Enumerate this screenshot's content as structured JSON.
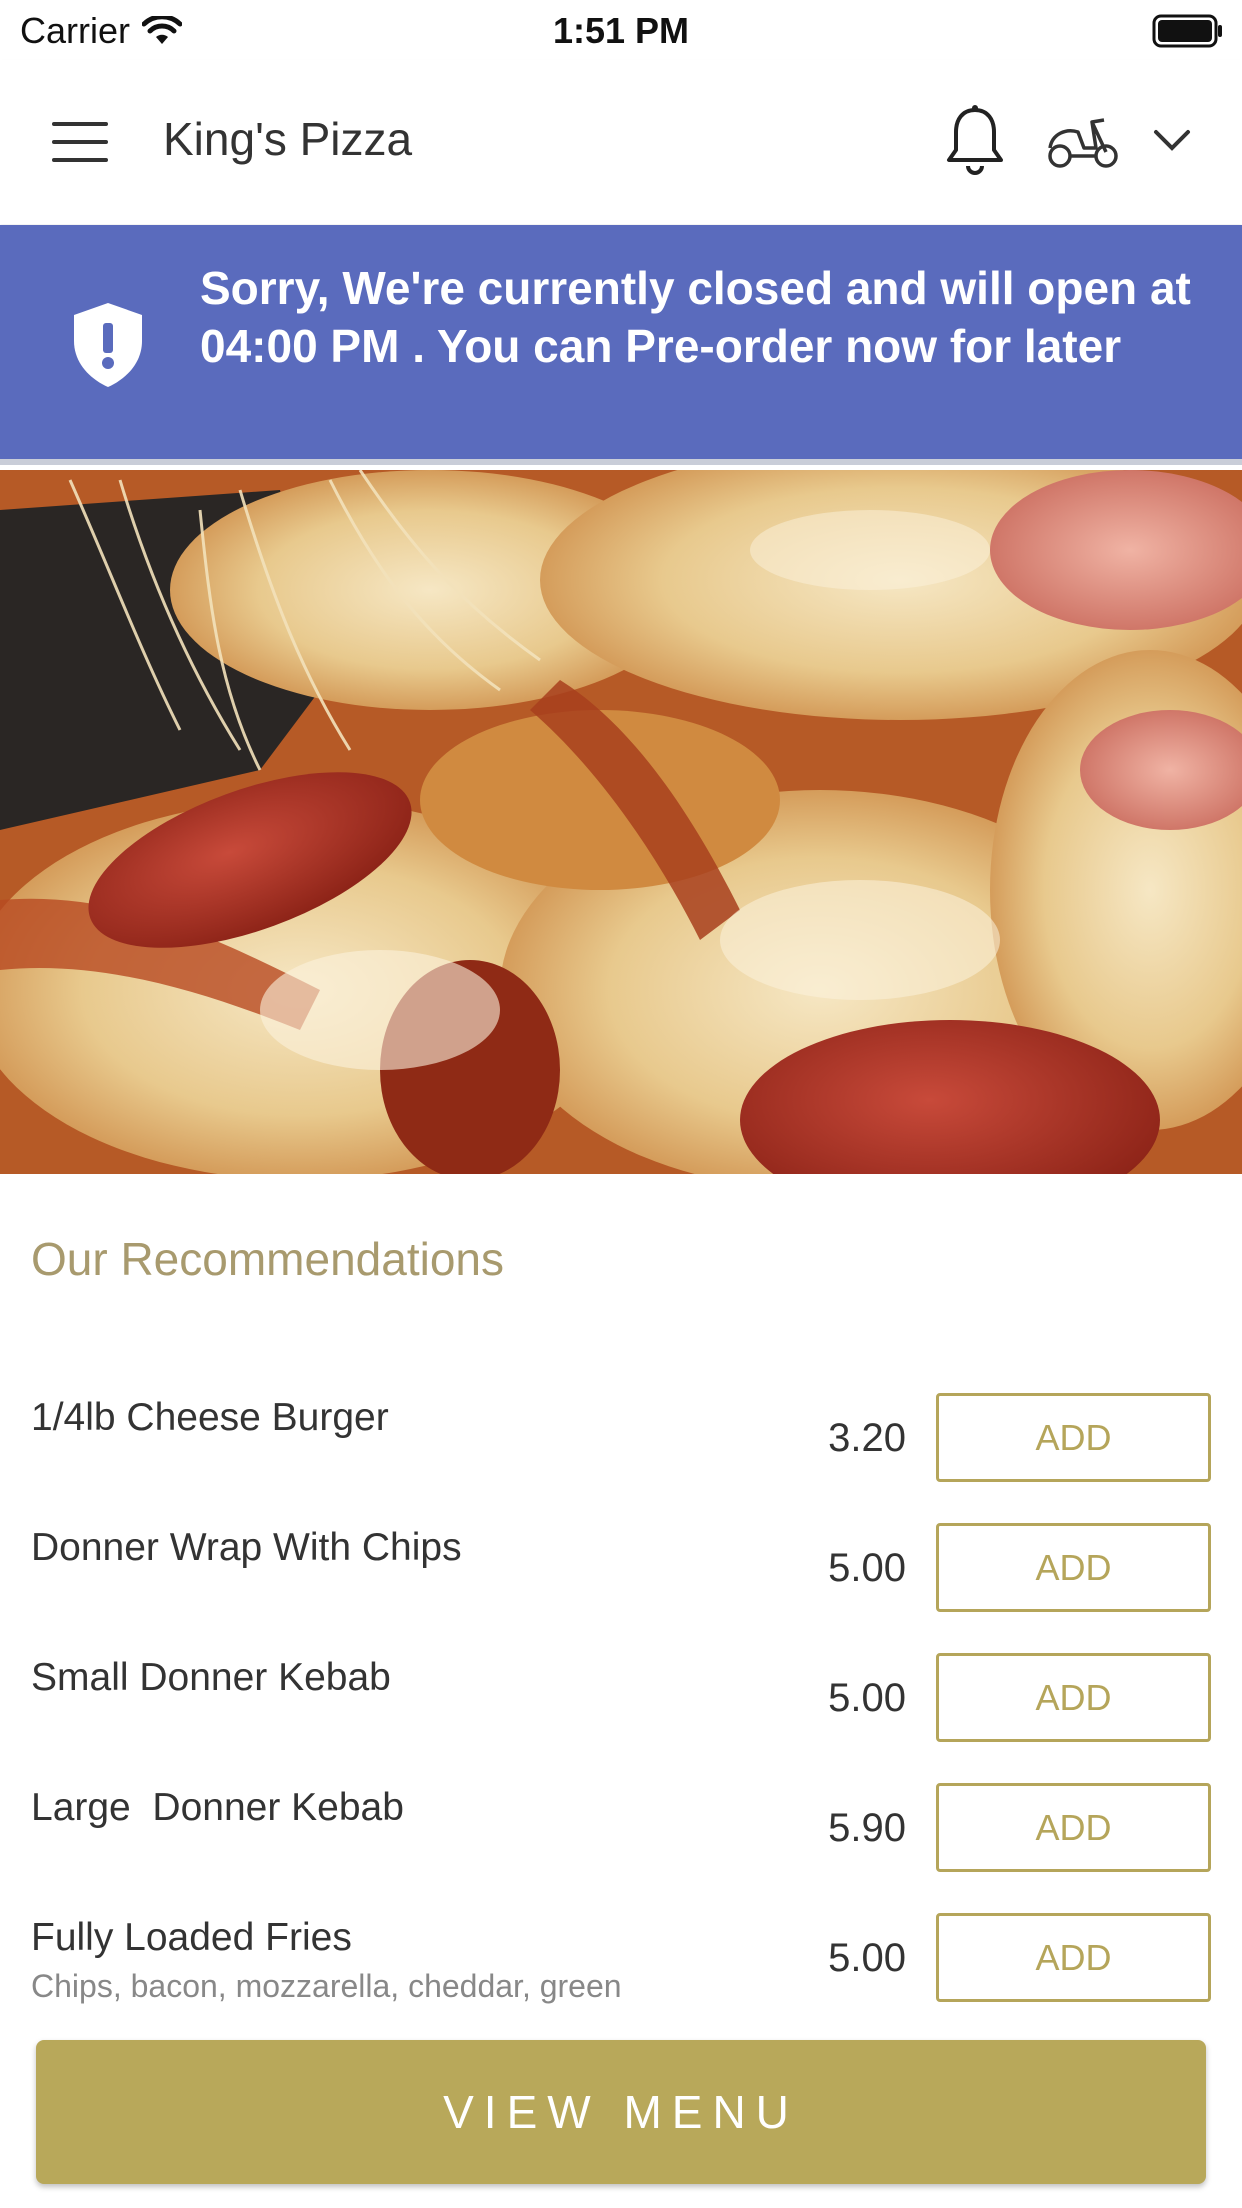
{
  "status_bar": {
    "carrier": "Carrier",
    "time": "1:51 PM"
  },
  "header": {
    "title": "King's Pizza",
    "icons": [
      "hamburger-menu-icon",
      "bell-icon",
      "scooter-icon",
      "chevron-down-icon"
    ]
  },
  "banner": {
    "message": "Sorry, We're currently closed and will open at 04:00 PM . You can Pre-order now for later",
    "color": "#5a6bbd",
    "icon": "shield-exclamation-icon"
  },
  "hero": {
    "icon": "pizza-photo"
  },
  "recommendations": {
    "title": "Our Recommendations",
    "add_label": "ADD",
    "items": [
      {
        "name": "1/4lb Cheese Burger",
        "price": "3.20",
        "description": ""
      },
      {
        "name": "Donner Wrap With Chips",
        "price": "5.00",
        "description": ""
      },
      {
        "name": "Small Donner Kebab",
        "price": "5.00",
        "description": ""
      },
      {
        "name": "Large  Donner Kebab",
        "price": "5.90",
        "description": ""
      },
      {
        "name": "Fully Loaded Fries",
        "price": "5.00",
        "description": "Chips, bacon, mozzarella, cheddar, green"
      }
    ]
  },
  "footer": {
    "view_menu_label": "VIEW MENU",
    "accent_color": "#b8a85a"
  }
}
